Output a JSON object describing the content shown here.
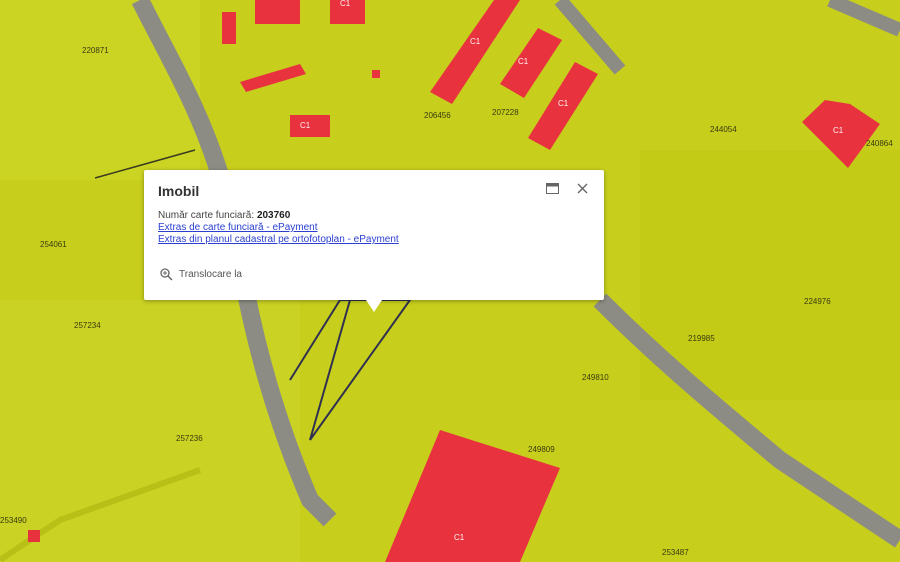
{
  "map": {
    "parcels": [
      "220871",
      "206456",
      "207228",
      "244054",
      "240864",
      "254061",
      "257234",
      "224976",
      "219985",
      "249810",
      "257236",
      "249809",
      "253490",
      "253487"
    ],
    "buildings": [
      "C1",
      "C1",
      "C1",
      "C1",
      "C1",
      "C1",
      "C1"
    ]
  },
  "popup": {
    "title": "Imobil",
    "field_label": "Număr carte funciară:",
    "field_value": "203760",
    "link1": "Extras de carte funciară - ePayment",
    "link2": "Extras din planul cadastral pe ortofotoplan - ePayment",
    "zoom_label": "Translocare la"
  },
  "colors": {
    "parcel_fill": "#c9d21e",
    "building": "#e8333f",
    "road": "#8a8a8a"
  }
}
